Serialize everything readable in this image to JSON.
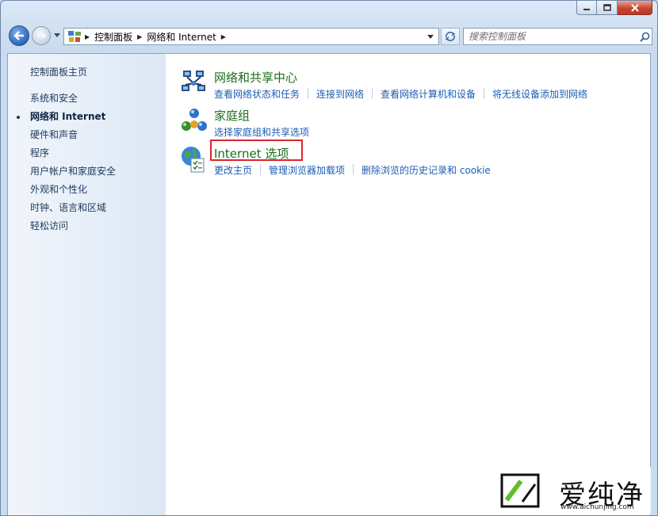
{
  "titlebar": {
    "buttons": [
      "minimize-icon",
      "maximize-icon",
      "close-icon"
    ]
  },
  "navbar": {
    "breadcrumb": [
      "控制面板",
      "网络和 Internet"
    ],
    "search_placeholder": "搜索控制面板"
  },
  "sidebar": {
    "home": "控制面板主页",
    "items": [
      {
        "label": "系统和安全",
        "current": false
      },
      {
        "label": "网络和 Internet",
        "current": true
      },
      {
        "label": "硬件和声音",
        "current": false
      },
      {
        "label": "程序",
        "current": false
      },
      {
        "label": "用户帐户和家庭安全",
        "current": false
      },
      {
        "label": "外观和个性化",
        "current": false
      },
      {
        "label": "时钟、语言和区域",
        "current": false
      },
      {
        "label": "轻松访问",
        "current": false
      }
    ]
  },
  "categories": [
    {
      "title": "网络和共享中心",
      "icon": "network-sharing-center-icon",
      "links": [
        "查看网络状态和任务",
        "连接到网络",
        "查看网络计算机和设备",
        "将无线设备添加到网络"
      ]
    },
    {
      "title": "家庭组",
      "icon": "homegroup-icon",
      "links": [
        "选择家庭组和共享选项"
      ]
    },
    {
      "title": "Internet 选项",
      "icon": "internet-options-icon",
      "links": [
        "更改主页",
        "管理浏览器加载项",
        "删除浏览的历史记录和 cookie"
      ],
      "highlighted": true
    }
  ],
  "watermark": {
    "text": "爱纯净",
    "url": "www.aichunjing.com"
  },
  "colors": {
    "category_title": "#1b6c18",
    "link": "#1c5db4",
    "highlight": "#d9272d"
  }
}
